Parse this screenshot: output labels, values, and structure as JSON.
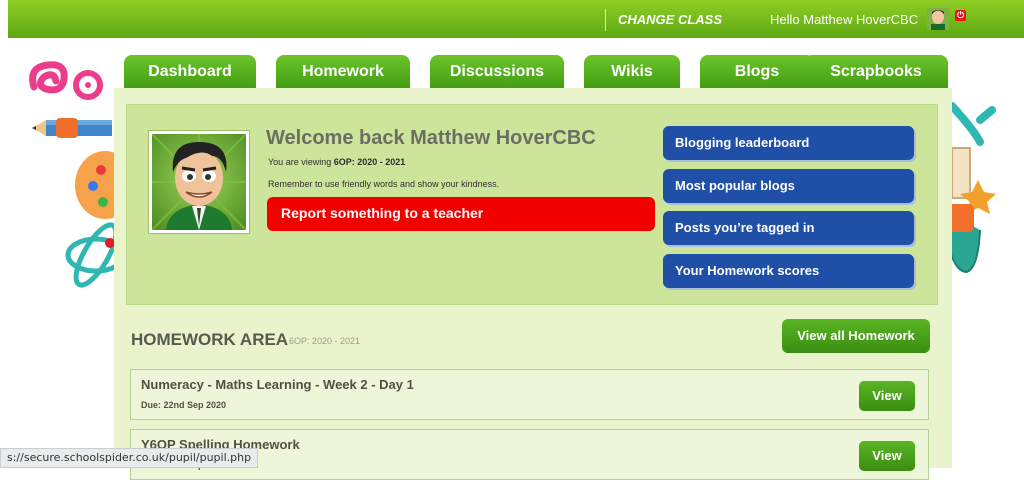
{
  "topbar": {
    "change_class": "CHANGE CLASS",
    "greeting": "Hello Matthew HoverCBC",
    "power_icon": "power-icon"
  },
  "tabs": [
    {
      "label": "Dashboard"
    },
    {
      "label": "Homework"
    },
    {
      "label": "Discussions"
    },
    {
      "label": "Wikis"
    },
    {
      "label": "Blogs"
    },
    {
      "label": "Scrapbooks"
    }
  ],
  "welcome": {
    "title": "Welcome back Matthew HoverCBC",
    "viewing_prefix": "You are viewing",
    "viewing_class": "6OP: 2020 - 2021",
    "note": "Remember to use friendly words and show your kindness.",
    "report_button": "Report something to a teacher"
  },
  "side_buttons": [
    {
      "label": "Blogging leaderboard"
    },
    {
      "label": "Most popular blogs"
    },
    {
      "label": "Posts you’re tagged in"
    },
    {
      "label": "Your Homework scores"
    }
  ],
  "homework": {
    "title": "HOMEWORK AREA",
    "subtitle": "6OP: 2020 - 2021",
    "view_all": "View all Homework",
    "items": [
      {
        "name": "Numeracy - Maths Learning - Week 2 - Day 1",
        "due": "Due: 22nd Sep 2020",
        "view": "View"
      },
      {
        "name": "Y6OP Spelling Homework",
        "due": "Due: 22nd Sep 2020",
        "view": "View"
      }
    ]
  },
  "status_url": "s://secure.schoolspider.co.uk/pupil/pupil.php",
  "colors": {
    "green": "#4fa81c",
    "panel": "#e9f4cc",
    "welcome_bg": "#cde59a",
    "blue_button": "#1f4fa7",
    "report_red": "#f20000"
  }
}
